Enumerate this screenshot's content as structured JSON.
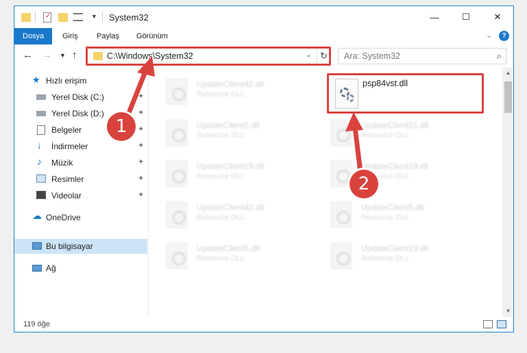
{
  "window": {
    "title": "System32"
  },
  "window_controls": {
    "minimize": "—",
    "maximize": "☐",
    "close": "✕"
  },
  "ribbon": {
    "tabs": [
      "Dosya",
      "Giriş",
      "Paylaş",
      "Görünüm"
    ]
  },
  "nav": {
    "address": "C:\\Windows\\System32",
    "search_placeholder": "Ara: System32"
  },
  "sidebar": {
    "items": [
      {
        "label": "Hızlı erişim",
        "icon": "star-icon"
      },
      {
        "label": "Yerel Disk (C:)",
        "icon": "drive-icon",
        "pinned": true
      },
      {
        "label": "Yerel Disk (D:)",
        "icon": "drive-icon",
        "pinned": true
      },
      {
        "label": "Belgeler",
        "icon": "documents-icon",
        "pinned": true
      },
      {
        "label": "İndirmeler",
        "icon": "download-icon",
        "pinned": true
      },
      {
        "label": "Müzik",
        "icon": "music-icon",
        "pinned": true
      },
      {
        "label": "Resimler",
        "icon": "pictures-icon",
        "pinned": true
      },
      {
        "label": "Videolar",
        "icon": "video-icon",
        "pinned": true
      },
      {
        "label": "OneDrive",
        "icon": "cloud-icon"
      },
      {
        "label": "Bu bilgisayar",
        "icon": "computer-icon",
        "selected": true
      },
      {
        "label": "Ağ",
        "icon": "network-icon"
      }
    ]
  },
  "files": [
    {
      "name": "UpdateClient42.dll",
      "type": "Resource DLL"
    },
    {
      "name": "UpdateClient5.dll",
      "type": "Resource DLL"
    },
    {
      "name": "UpdateClient21.dll",
      "type": "Resource DLL"
    },
    {
      "name": "UpdateClient19.dll",
      "type": "Resource DLL"
    },
    {
      "name": "UpdateClient19.dll",
      "type": "Resource DLL"
    },
    {
      "name": "UpdateClient42.dll",
      "type": "Resource DLL"
    },
    {
      "name": "UpdateClient5.dll",
      "type": "Resource DLL"
    },
    {
      "name": "UpdateClient5.dll",
      "type": "Resource DLL"
    },
    {
      "name": "UpdateClient19.dll",
      "type": "Resource DLL"
    }
  ],
  "target_file": {
    "name": "psp84vst.dll"
  },
  "status": {
    "count": "119 öğe"
  },
  "callouts": [
    "1",
    "2"
  ],
  "colors": {
    "accent": "#1979ca",
    "highlight": "#d9433e",
    "selected": "#cce4f7"
  }
}
